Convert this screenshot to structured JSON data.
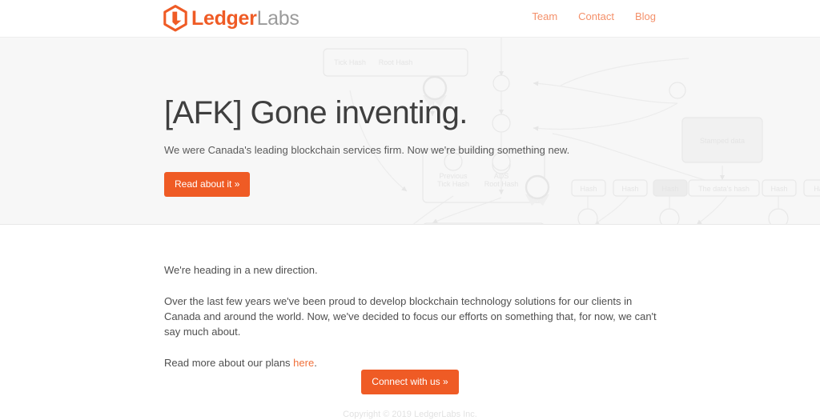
{
  "header": {
    "brand": {
      "primary": "Ledger",
      "secondary": "Labs",
      "logo_icon": "hexagon-l-logo-icon"
    },
    "nav": [
      {
        "label": "Team"
      },
      {
        "label": "Contact"
      },
      {
        "label": "Blog"
      }
    ]
  },
  "hero": {
    "title": "[AFK] Gone inventing.",
    "subtitle": "We were Canada's leading blockchain services firm. Now we're building something new.",
    "cta_label": "Read about it »",
    "background_diagram": {
      "labels": [
        "Tick Hash",
        "Root Hash",
        "Previous Tick Hash",
        "ADS Root Hash",
        "Stamped data",
        "The data's hash",
        "Hash",
        "ADS"
      ]
    }
  },
  "main": {
    "paragraph_1": "We're heading in a new direction.",
    "paragraph_2": "Over the last few years we've been proud to develop blockchain technology solutions for our clients in Canada and around the world. Now, we've decided to focus our efforts on something that, for now, we can't say much about.",
    "paragraph_3_before": "Read more about our plans ",
    "paragraph_3_link": "here",
    "paragraph_3_after": ".",
    "connect_label": "Connect with us »",
    "footer_note": "Copyright © 2019 LedgerLabs Inc."
  },
  "colors": {
    "accent": "#ef5b25",
    "nav_link": "#f4906a",
    "hero_background": "#f7f7f7",
    "heading_text": "#3f3f3f",
    "body_text": "#4f4f4f",
    "diagram_line": "#ebebeb"
  }
}
